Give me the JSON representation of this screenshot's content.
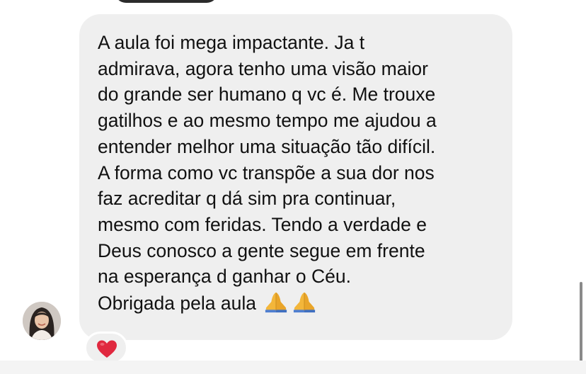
{
  "message": {
    "lines": [
      "A aula foi mega impactante. Ja t",
      "admirava, agora tenho uma visão maior",
      "do grande ser humano q vc é. Me trouxe",
      "gatilhos e ao mesmo tempo me ajudou a",
      "entender melhor uma situação tão difícil.",
      "A forma como vc transpõe a sua dor nos",
      "faz acreditar q dá sim pra continuar,",
      "mesmo com feridas. Tendo a verdade e",
      "Deus conosco a gente segue em frente",
      "na esperança d ganhar o Céu.",
      "Obrigada pela aula"
    ],
    "trailing_emoji": "folded-hands-icon x2"
  },
  "reaction": {
    "emoji": "heart-icon"
  },
  "colors": {
    "bubble": "#efefef",
    "text": "#111111",
    "heart": "#e0283f",
    "prayer_hands": "#f3b63a",
    "previous_bubble": "#2b2b2b"
  }
}
